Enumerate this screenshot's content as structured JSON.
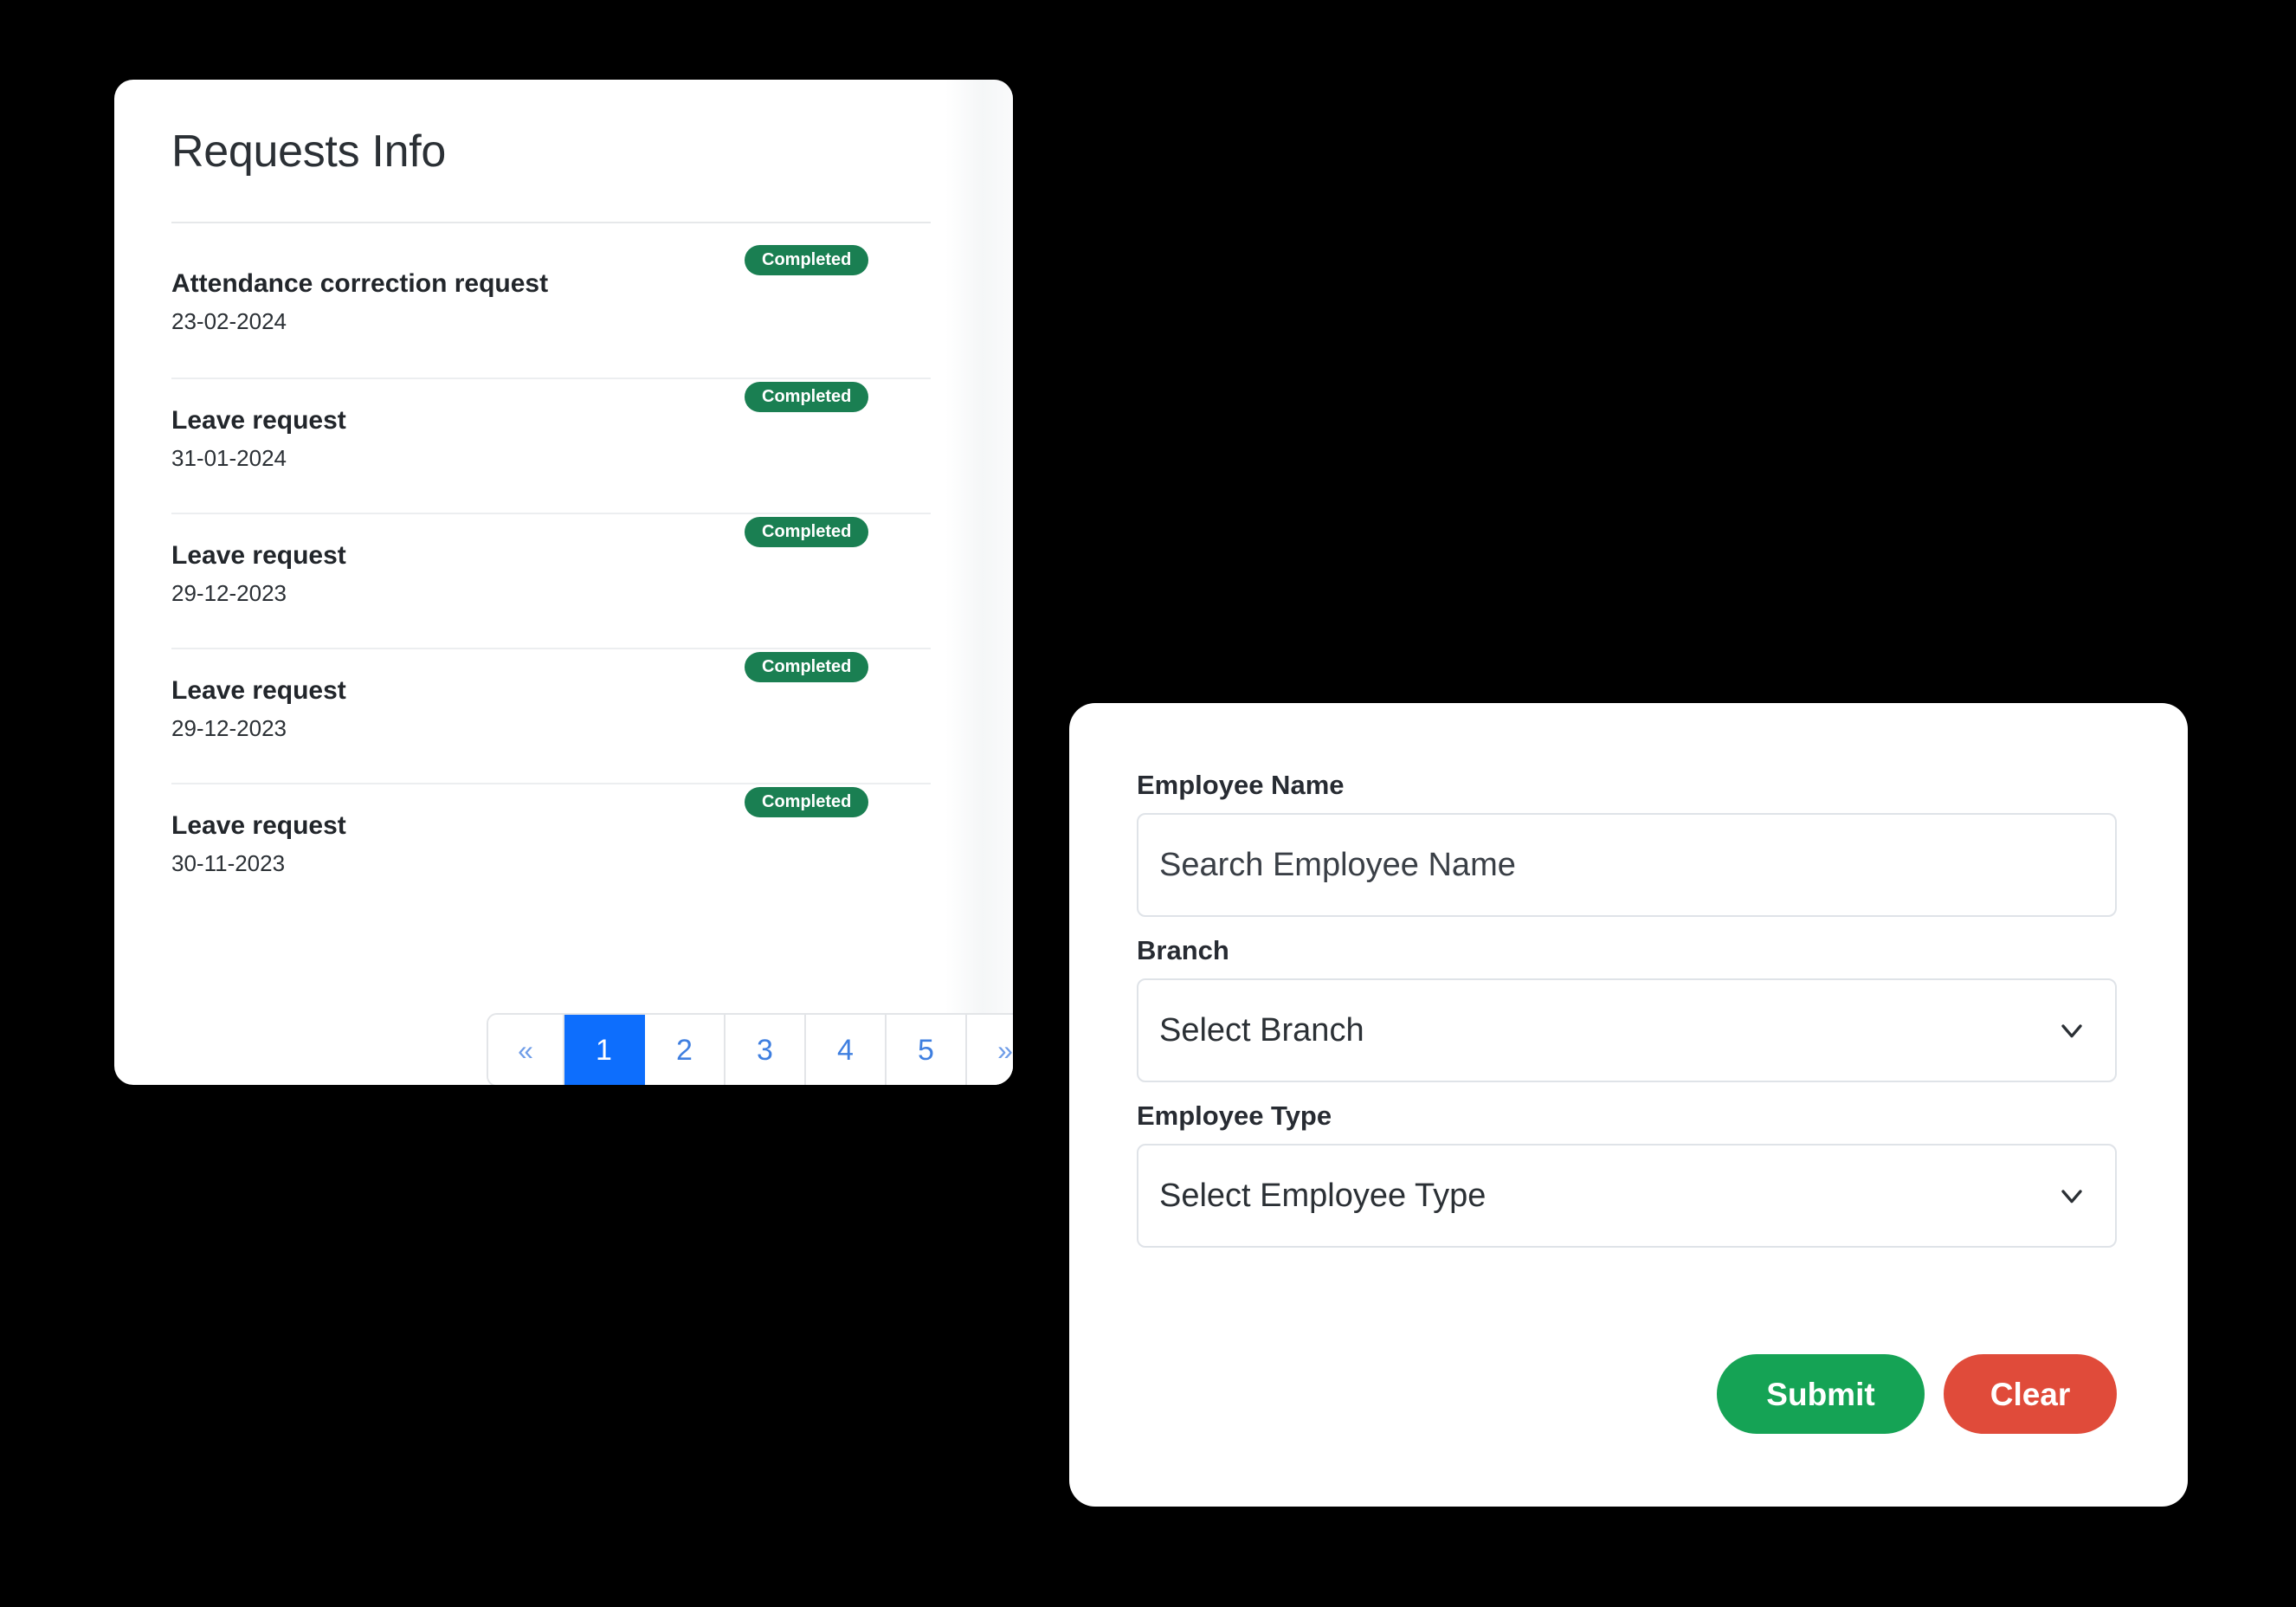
{
  "background_color": "#000000",
  "requests_card": {
    "title": "Requests Info",
    "items": [
      {
        "title": "Attendance correction request",
        "date": "23-02-2024",
        "status": "Completed"
      },
      {
        "title": "Leave request",
        "date": "31-01-2024",
        "status": "Completed"
      },
      {
        "title": "Leave request",
        "date": "29-12-2023",
        "status": "Completed"
      },
      {
        "title": "Leave request",
        "date": "29-12-2023",
        "status": "Completed"
      },
      {
        "title": "Leave request",
        "date": "30-11-2023",
        "status": "Completed"
      }
    ],
    "status_color": "#1a7f52",
    "pagination": {
      "prev_label": "«",
      "next_label": "»",
      "pages": [
        "1",
        "2",
        "3",
        "4",
        "5"
      ],
      "active_page": "1",
      "active_color": "#0d6efd",
      "link_color": "#3f7fe0"
    }
  },
  "filter_card": {
    "employee_name": {
      "label": "Employee Name",
      "placeholder": "Search Employee Name",
      "value": ""
    },
    "branch": {
      "label": "Branch",
      "selected": "Select Branch",
      "icon": "chevron-down-icon"
    },
    "employee_type": {
      "label": "Employee Type",
      "selected": "Select Employee Type",
      "icon": "chevron-down-icon"
    },
    "submit_label": "Submit",
    "clear_label": "Clear",
    "submit_color": "#15a355",
    "clear_color": "#e04b3a"
  }
}
